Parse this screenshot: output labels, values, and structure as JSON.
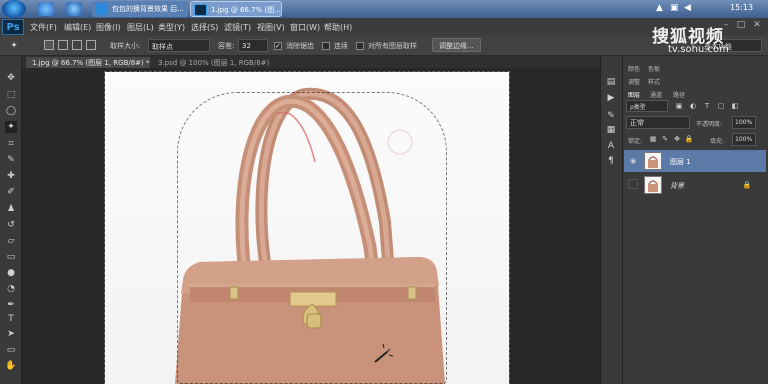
{
  "taskbar": {
    "tasks": [
      "包包的换背景效果 后...",
      "1.jpg @ 66.7% (图..."
    ],
    "clock": "15:13"
  },
  "menu": {
    "app_logo": "Ps",
    "items": [
      "文件(F)",
      "编辑(E)",
      "图像(I)",
      "图层(L)",
      "类型(Y)",
      "选择(S)",
      "滤镜(T)",
      "视图(V)",
      "窗口(W)",
      "帮助(H)"
    ],
    "workspace": "基本功能"
  },
  "options": {
    "sample_size_label": "取样大小:",
    "sample_size_value": "取样点",
    "tolerance_label": "容差:",
    "tolerance_value": "32",
    "anti_alias_label": "消除锯齿",
    "contiguous_label": "连续",
    "sample_all_layers_label": "对所有图层取样",
    "refine_edge_button": "调整边缘..."
  },
  "doc_tabs": [
    "1.jpg @ 66.7% (图层 1, RGB/8#) *",
    "3.psd @ 100% (图层 1, RGB/8#)"
  ],
  "watermark": {
    "brand": "搜狐视频",
    "url": "tv.sohu.com"
  },
  "panel": {
    "top_tabs": [
      "颜色",
      "色板"
    ],
    "adjust_tabs": [
      "调整",
      "样式"
    ],
    "layer_tabs": [
      "图层",
      "通道",
      "路径"
    ],
    "filter_kind": "ρ类型",
    "blend_mode": "正常",
    "opacity_label": "不透明度:",
    "opacity_value": "100%",
    "lock_label": "锁定:",
    "fill_label": "填充:",
    "fill_value": "100%",
    "layers": [
      "图层 1",
      "背景"
    ]
  },
  "colors": {
    "accent": "#5b7aa8",
    "bag": "#c9927a"
  }
}
